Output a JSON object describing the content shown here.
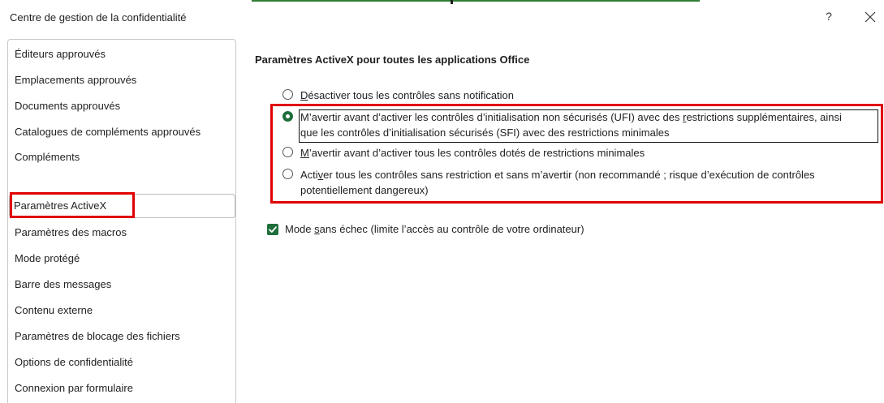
{
  "dialog": {
    "title": "Centre de gestion de la confidentialité",
    "help_label": "?"
  },
  "sidebar": {
    "items": [
      {
        "label": "Éditeurs approuvés"
      },
      {
        "label": "Emplacements approuvés"
      },
      {
        "label": "Documents approuvés"
      },
      {
        "label": "Catalogues de compléments approuvés"
      },
      {
        "label": "Compléments"
      },
      {
        "label": "Paramètres ActiveX"
      },
      {
        "label": "Paramètres des macros"
      },
      {
        "label": "Mode protégé"
      },
      {
        "label": "Barre des messages"
      },
      {
        "label": "Contenu externe"
      },
      {
        "label": "Paramètres de blocage des fichiers"
      },
      {
        "label": "Options de confidentialité"
      },
      {
        "label": "Connexion par formulaire"
      }
    ],
    "selected": "Paramètres ActiveX"
  },
  "main": {
    "section_title": "Paramètres ActiveX pour toutes les applications Office",
    "options": [
      {
        "pre": "",
        "key": "D",
        "post": "ésactiver tous les contrôles sans notification",
        "checked": false
      },
      {
        "pre": "M’avertir avant d’activer les contrôles d’initialisation non sécurisés (UFI) avec des ",
        "key": "r",
        "post": "estrictions supplémentaires, ainsi",
        "line2": "que les contrôles d’initialisation sécurisés (SFI) avec des restrictions minimales",
        "checked": true
      },
      {
        "pre": "",
        "key": "M",
        "post": "’avertir avant d’activer tous les contrôles dotés de restrictions minimales",
        "checked": false
      },
      {
        "pre": "Acti",
        "key": "v",
        "post": "er tous les contrôles sans restriction et sans m’avertir (non recommandé ; risque d’exécution de contrôles",
        "line2": "potentiellement dangereux)",
        "checked": false
      }
    ],
    "safe_mode": {
      "pre": "Mode ",
      "key": "s",
      "post": "ans échec (limite l’accès au contrôle de votre ordinateur)",
      "checked": true
    }
  },
  "colors": {
    "accent": "#1e6f3c",
    "highlight": "#e00000"
  },
  "icons": [
    "help-icon",
    "close-icon",
    "checkmark-icon",
    "radio-selected-icon",
    "radio-unselected-icon"
  ]
}
